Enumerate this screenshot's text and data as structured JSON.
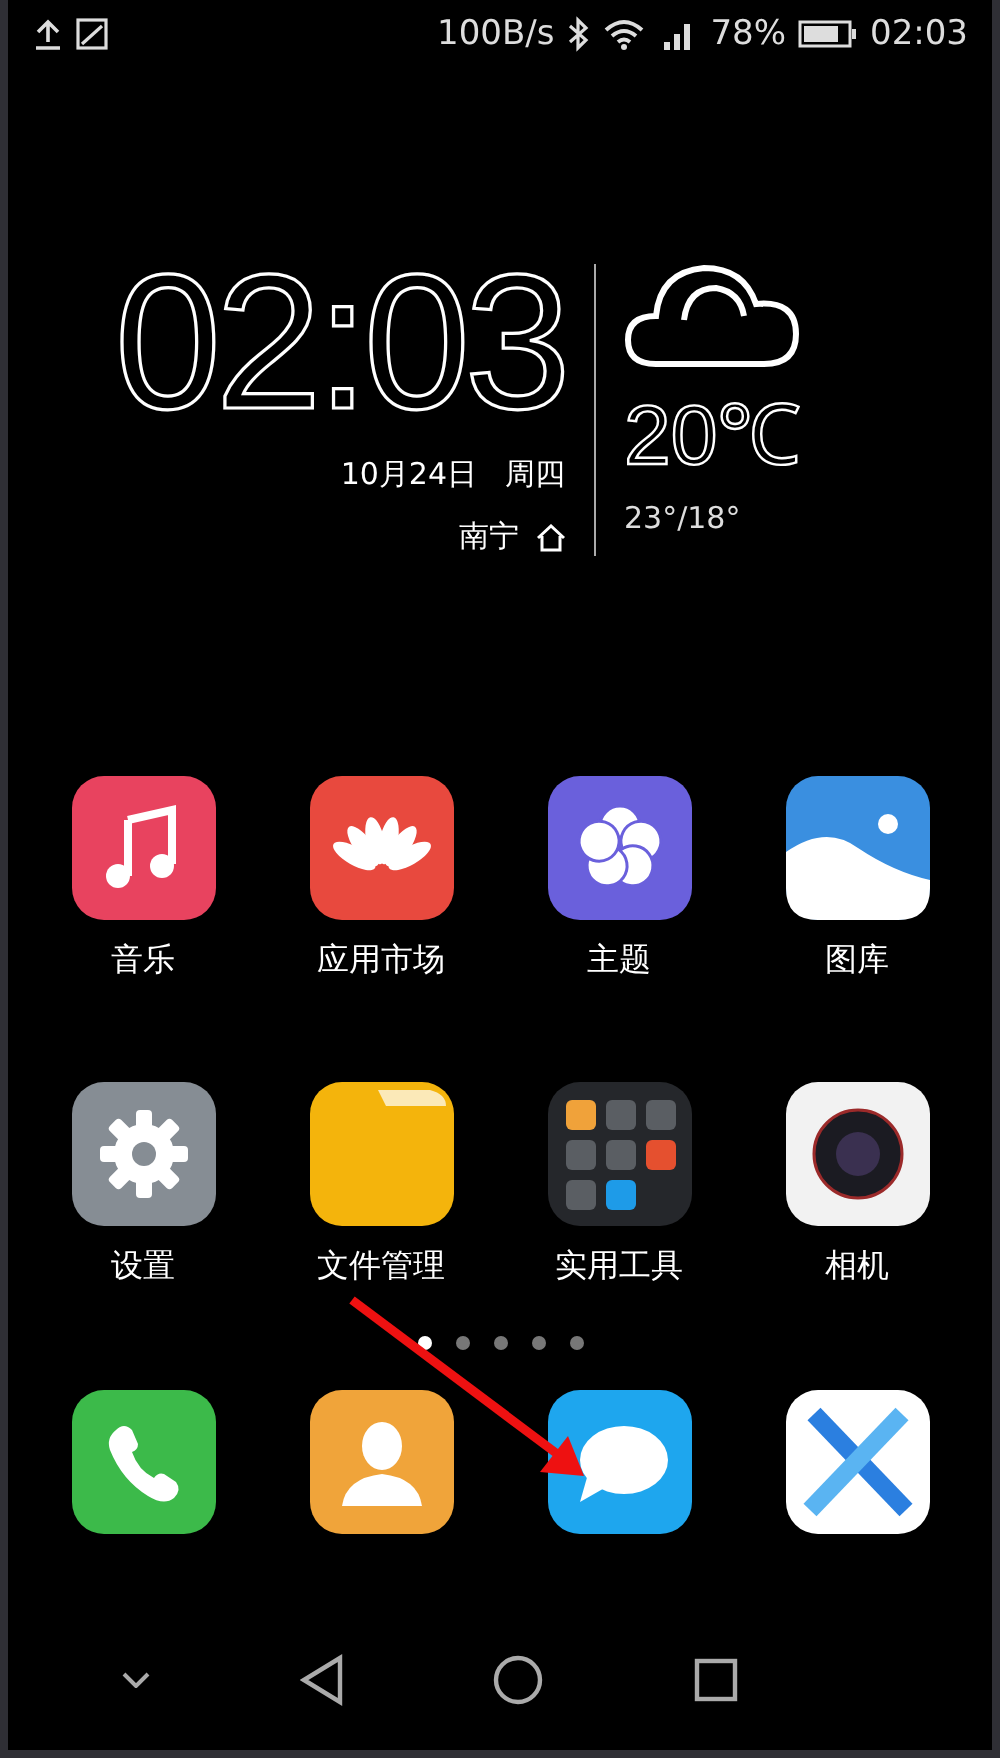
{
  "status_bar": {
    "network_speed": "100B/s",
    "battery": "78%",
    "time": "02:03"
  },
  "clock_widget": {
    "time": "02:03",
    "date": "10月24日",
    "weekday": "周四",
    "city": "南宁",
    "temperature": "20℃",
    "range": "23°/18°"
  },
  "apps": [
    {
      "label": "音乐",
      "kind": "music"
    },
    {
      "label": "应用市场",
      "kind": "store"
    },
    {
      "label": "主题",
      "kind": "theme"
    },
    {
      "label": "图库",
      "kind": "gallery"
    },
    {
      "label": "设置",
      "kind": "settings"
    },
    {
      "label": "文件管理",
      "kind": "files"
    },
    {
      "label": "实用工具",
      "kind": "tools"
    },
    {
      "label": "相机",
      "kind": "camera"
    }
  ],
  "page_dots": [
    {
      "selected": true
    },
    {
      "selected": false
    },
    {
      "selected": false
    },
    {
      "selected": false
    },
    {
      "selected": false
    }
  ],
  "dock": [
    {
      "kind": "phone"
    },
    {
      "kind": "contacts"
    },
    {
      "kind": "messages"
    },
    {
      "kind": "browser"
    }
  ]
}
